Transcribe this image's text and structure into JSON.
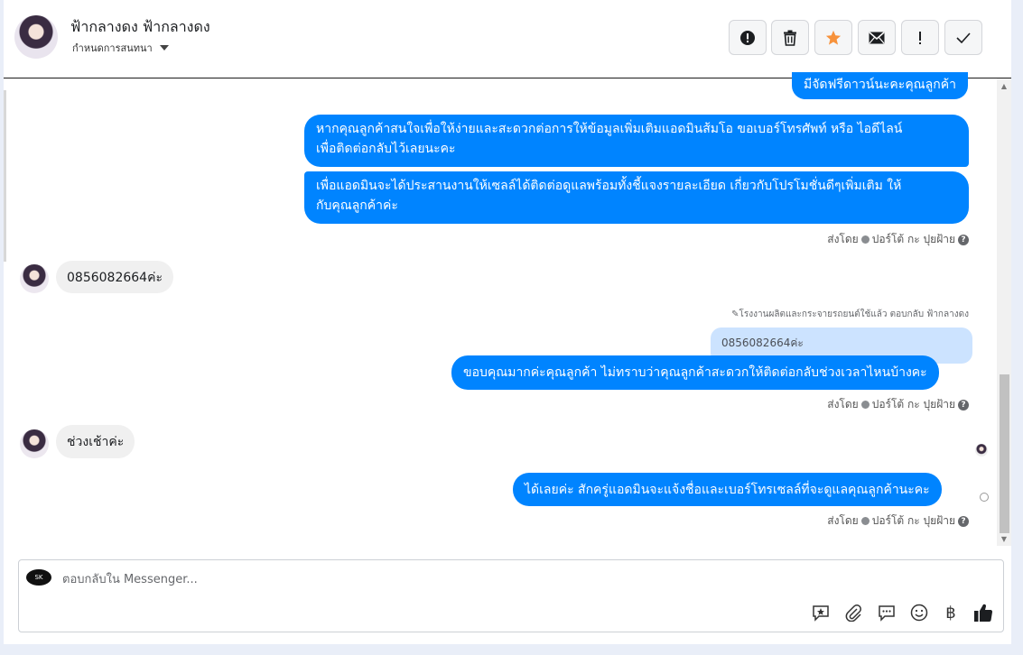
{
  "header": {
    "contact_name": "ฟ้ากลางดง ฟ้ากลางดง",
    "assign_label": "กำหนดการสนทนา",
    "actions": [
      {
        "name": "report-spam-button",
        "icon": "alert-circle-icon"
      },
      {
        "name": "delete-button",
        "icon": "trash-icon"
      },
      {
        "name": "star-button",
        "icon": "star-icon",
        "color": "#f7923b"
      },
      {
        "name": "mark-unread-button",
        "icon": "envelope-icon"
      },
      {
        "name": "follow-up-button",
        "icon": "exclamation-icon"
      },
      {
        "name": "mark-done-button",
        "icon": "check-icon"
      }
    ]
  },
  "messages": {
    "m1": "มีจัดฟรีดาวน์นะคะคุณลูกค้า",
    "m2a": "หากคุณลูกค้าสนใจเพื่อให้ง่ายและสะดวกต่อการให้ข้อมูลเพิ่มเติมแอดมินส้มโอ ขอเบอร์โทรศัพท์ หรือ ไอดีไลน์",
    "m2b": "เพื่อติดต่อกลับไว้เลยนะคะ",
    "m3a": "เพื่อแอดมินจะได้ประสานงานให้เซลล์ได้ติดต่อดูแลพร้อมทั้งชี้แจงรายละเอียด เกี่ยวกับโปรโมชั่นดีๆเพิ่มเติม ให้",
    "m3b": "กับคุณลูกค้าค่ะ",
    "in1": "0856082664ค่ะ",
    "reply_meta": "โรงงานผลิตและกระจายรถยนต์ใช้แล้ว ตอบกลับ ฟ้ากลางดง",
    "quoted": "0856082664ค่ะ",
    "m4": "ขอบคุณมากค่ะคุณลูกค้า ไม่ทราบว่าคุณลูกค้าสะดวกให้ติดต่อกลับช่วงเวลาไหนบ้างคะ",
    "in2": "ช่วงเช้าค่ะ",
    "m5": "ได้เลยค่ะ สักครู่แอดมินจะแจ้งชื่อและเบอร์โทรเซลล์ที่จะดูแลคุณลูกค้านะคะ"
  },
  "sent_by": {
    "prefix": "ส่งโดย",
    "name": "ปอร์โต้ กะ ปุยฝ้าย"
  },
  "composer": {
    "placeholder": "ตอบกลับใน Messenger...",
    "page_logo": "SK",
    "currency_symbol": "฿"
  },
  "colors": {
    "outgoing_bubble": "#0084ff",
    "incoming_bubble": "#f0f0f0",
    "quoted_bubble": "#cce3ff",
    "star": "#f7923b"
  }
}
